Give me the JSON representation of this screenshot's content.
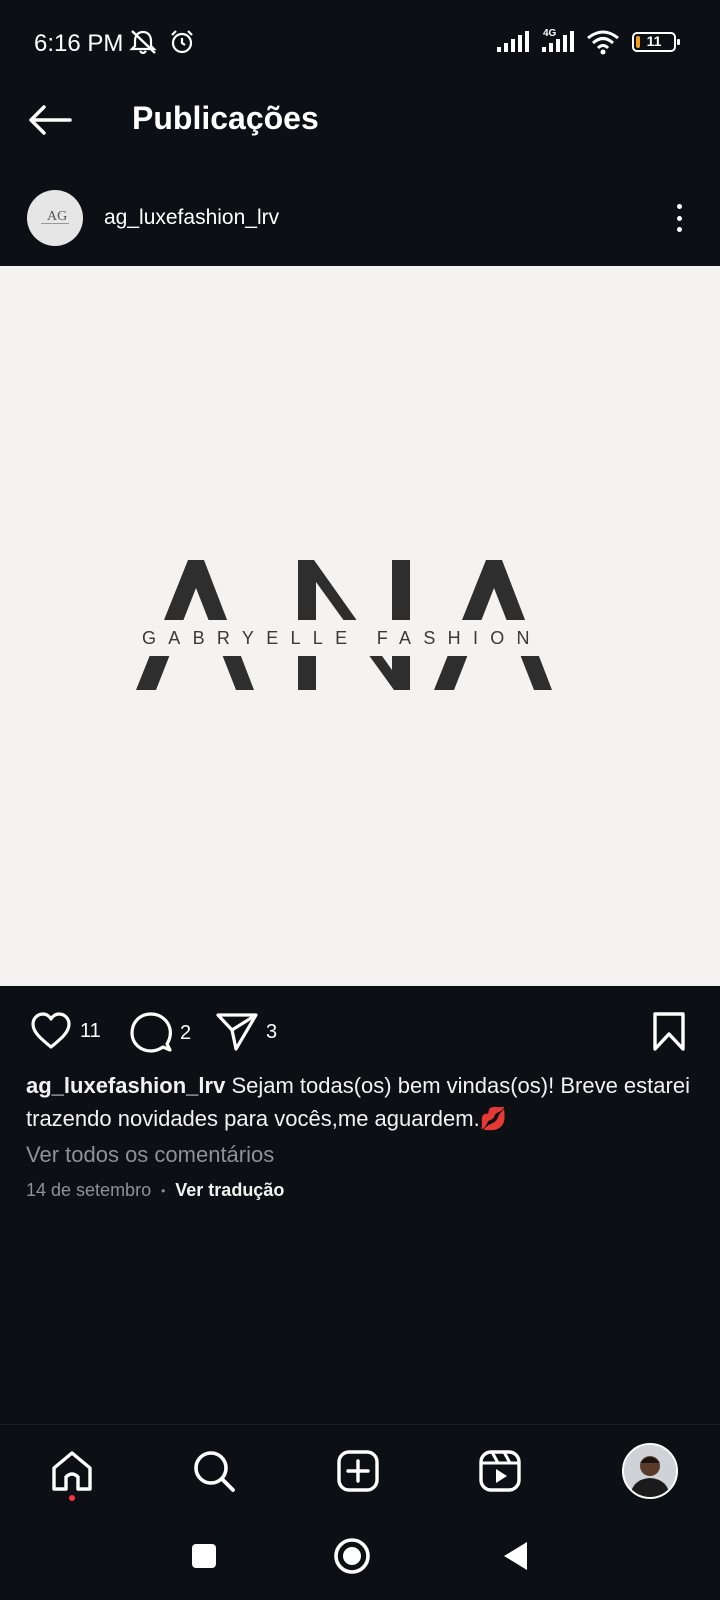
{
  "status_bar": {
    "time": "6:16 PM",
    "network": "4G",
    "battery": "11",
    "battery_level": 0.11,
    "icons": [
      "mute-notifications-icon",
      "alarm-icon",
      "signal-icon",
      "signal-4g-icon",
      "wifi-icon",
      "battery-icon"
    ]
  },
  "header": {
    "title": "Publicações",
    "back_icon": "back-arrow-icon"
  },
  "post": {
    "username": "ag_luxefashion_lrv",
    "image_logo": {
      "brand_letters": "ANA",
      "brand_text": "GABRYELLE FASHION"
    },
    "likes": "11",
    "comments": "2",
    "shares": "3",
    "caption_user": "ag_luxefashion_lrv",
    "caption_text": "Sejam todas(os) bem vindas(os)! Breve estarei trazendo novidades para vocês,me aguardem.💋",
    "view_comments": "Ver todos os comentários",
    "date": "14 de setembro",
    "translate": "Ver tradução"
  },
  "bottom_nav": {
    "items": [
      "home-icon",
      "search-icon",
      "create-post-icon",
      "reels-icon",
      "profile-avatar"
    ]
  },
  "system_nav": {
    "items": [
      "recents-button",
      "home-button",
      "back-button"
    ]
  },
  "colors": {
    "background": "#0c0f14",
    "post_image_bg": "#f4f3f2",
    "logo_dark": "#2e2e2e",
    "secondary_text": "#8e9197",
    "notification_dot": "#ff3040"
  }
}
